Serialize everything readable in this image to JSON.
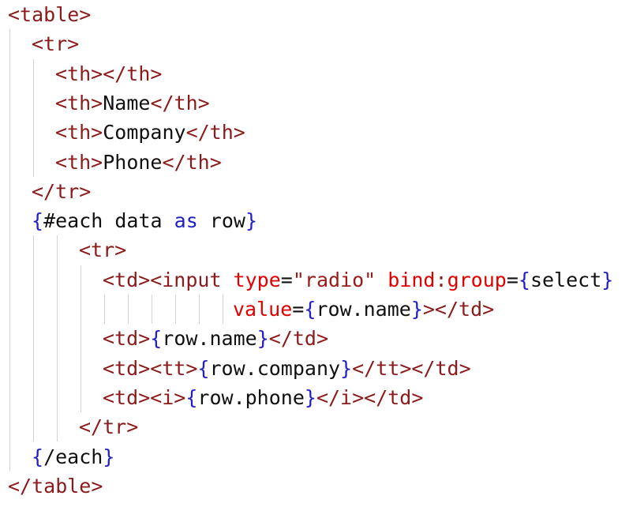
{
  "theme": {
    "tag_color": "#8b1a1a",
    "attr_name_color": "#e00000",
    "string_color": "#9b1a1a",
    "brace_color": "#2020c8",
    "keyword_color": "#2020c8",
    "text_color": "#111111",
    "guide_color": "#d3d3d3"
  },
  "code_lines": [
    {
      "indent": 0,
      "tokens": [
        {
          "t": "tag",
          "v": "<table>"
        }
      ]
    },
    {
      "indent": 1,
      "tokens": [
        {
          "t": "tag",
          "v": "<tr>"
        }
      ]
    },
    {
      "indent": 2,
      "tokens": [
        {
          "t": "tag",
          "v": "<th></th>"
        }
      ]
    },
    {
      "indent": 2,
      "tokens": [
        {
          "t": "tag",
          "v": "<th>"
        },
        {
          "t": "text",
          "v": "Name"
        },
        {
          "t": "tag",
          "v": "</th>"
        }
      ]
    },
    {
      "indent": 2,
      "tokens": [
        {
          "t": "tag",
          "v": "<th>"
        },
        {
          "t": "text",
          "v": "Company"
        },
        {
          "t": "tag",
          "v": "</th>"
        }
      ]
    },
    {
      "indent": 2,
      "tokens": [
        {
          "t": "tag",
          "v": "<th>"
        },
        {
          "t": "text",
          "v": "Phone"
        },
        {
          "t": "tag",
          "v": "</th>"
        }
      ]
    },
    {
      "indent": 1,
      "tokens": [
        {
          "t": "tag",
          "v": "</tr>"
        }
      ]
    },
    {
      "indent": 1,
      "tokens": [
        {
          "t": "brace",
          "v": "{"
        },
        {
          "t": "text",
          "v": "#each data "
        },
        {
          "t": "keyword",
          "v": "as"
        },
        {
          "t": "text",
          "v": " row"
        },
        {
          "t": "brace",
          "v": "}"
        }
      ]
    },
    {
      "indent": 3,
      "tokens": [
        {
          "t": "tag",
          "v": "<tr>"
        }
      ]
    },
    {
      "indent": 4,
      "tokens": [
        {
          "t": "tag",
          "v": "<td><input "
        },
        {
          "t": "attr",
          "v": "type"
        },
        {
          "t": "text",
          "v": "="
        },
        {
          "t": "string",
          "v": "\"radio\""
        },
        {
          "t": "text",
          "v": " "
        },
        {
          "t": "attr",
          "v": "bind"
        },
        {
          "t": "tag",
          "v": ":"
        },
        {
          "t": "attr",
          "v": "group"
        },
        {
          "t": "text",
          "v": "="
        },
        {
          "t": "brace",
          "v": "{"
        },
        {
          "t": "text",
          "v": "select"
        },
        {
          "t": "brace",
          "v": "}"
        }
      ]
    },
    {
      "indent": 9.5,
      "tokens": [
        {
          "t": "attr",
          "v": "value"
        },
        {
          "t": "text",
          "v": "="
        },
        {
          "t": "brace",
          "v": "{"
        },
        {
          "t": "text",
          "v": "row.name"
        },
        {
          "t": "brace",
          "v": "}"
        },
        {
          "t": "tag",
          "v": "></td>"
        }
      ]
    },
    {
      "indent": 4,
      "tokens": [
        {
          "t": "tag",
          "v": "<td>"
        },
        {
          "t": "brace",
          "v": "{"
        },
        {
          "t": "text",
          "v": "row.name"
        },
        {
          "t": "brace",
          "v": "}"
        },
        {
          "t": "tag",
          "v": "</td>"
        }
      ]
    },
    {
      "indent": 4,
      "tokens": [
        {
          "t": "tag",
          "v": "<td><tt>"
        },
        {
          "t": "brace",
          "v": "{"
        },
        {
          "t": "text",
          "v": "row.company"
        },
        {
          "t": "brace",
          "v": "}"
        },
        {
          "t": "tag",
          "v": "</tt></td>"
        }
      ]
    },
    {
      "indent": 4,
      "tokens": [
        {
          "t": "tag",
          "v": "<td><i>"
        },
        {
          "t": "brace",
          "v": "{"
        },
        {
          "t": "text",
          "v": "row.phone"
        },
        {
          "t": "brace",
          "v": "}"
        },
        {
          "t": "tag",
          "v": "</i></td>"
        }
      ]
    },
    {
      "indent": 3,
      "tokens": [
        {
          "t": "tag",
          "v": "</tr>"
        }
      ]
    },
    {
      "indent": 1,
      "tokens": [
        {
          "t": "brace",
          "v": "{"
        },
        {
          "t": "text",
          "v": "/each"
        },
        {
          "t": "brace",
          "v": "}"
        }
      ]
    },
    {
      "indent": 0,
      "tokens": [
        {
          "t": "tag",
          "v": "</table>"
        }
      ]
    }
  ]
}
